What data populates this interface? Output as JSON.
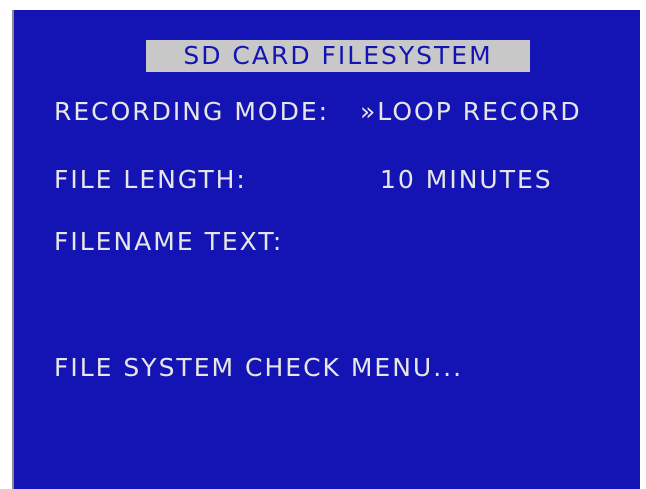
{
  "screen": {
    "title": "SD CARD FILESYSTEM",
    "background": "#1414b4",
    "text_color": "#e6e6e6",
    "highlight_color": "#c8c8c8"
  },
  "menu": {
    "recording_mode": {
      "label": "RECORDING MODE:",
      "value": "»LOOP RECORD"
    },
    "file_length": {
      "label": "FILE LENGTH:",
      "value": "10 MINUTES"
    },
    "filename_text": {
      "label": "FILENAME TEXT:",
      "value": ""
    },
    "file_system_check": {
      "label": "FILE SYSTEM CHECK MENU..."
    }
  }
}
